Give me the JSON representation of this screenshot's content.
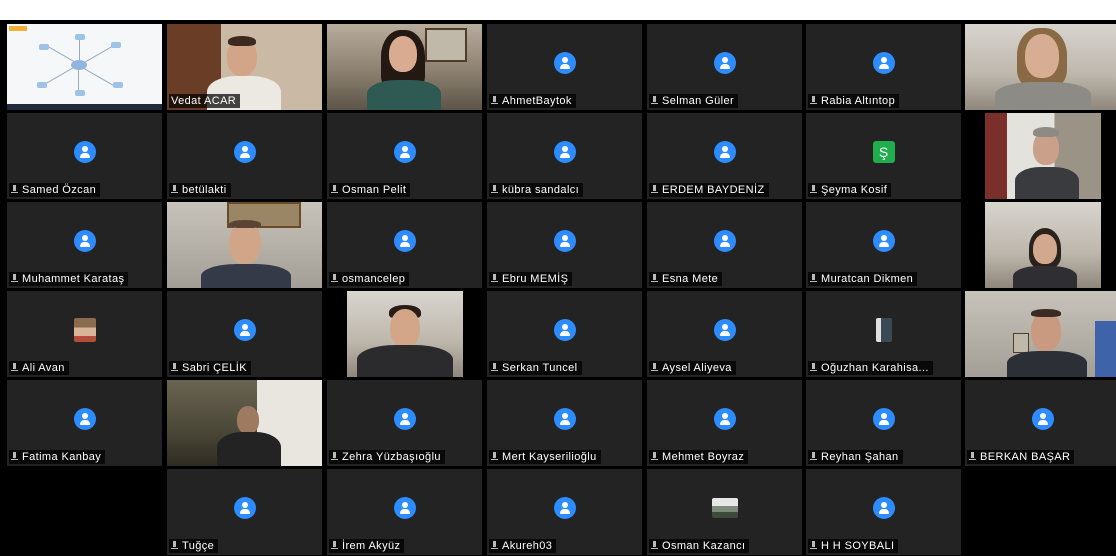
{
  "participants": {
    "screen_share": {
      "label": ""
    },
    "vedat": {
      "name": "Vedat ACAR"
    },
    "p2": {
      "name": ""
    },
    "ahmet": {
      "name": "AhmetBaytok"
    },
    "selman": {
      "name": "Selman Güler"
    },
    "rabia": {
      "name": "Rabia Altıntop"
    },
    "p7": {
      "name": ""
    },
    "samed": {
      "name": "Samed Özcan"
    },
    "betul": {
      "name": "betülakti"
    },
    "osman_pelit": {
      "name": "Osman Pelit"
    },
    "kubra": {
      "name": "kübra sandalcı"
    },
    "erdem": {
      "name": "ERDEM BAYDENİZ"
    },
    "seyma": {
      "name": "Şeyma Kosif",
      "initial": "Ş"
    },
    "p14": {
      "name": ""
    },
    "muhammet": {
      "name": "Muhammet Karataş"
    },
    "p16": {
      "name": ""
    },
    "osmancelep": {
      "name": "osmancelep"
    },
    "ebru": {
      "name": "Ebru MEMİŞ"
    },
    "esna": {
      "name": "Esna Mete"
    },
    "muratcan": {
      "name": "Muratcan Dikmen"
    },
    "p21": {
      "name": ""
    },
    "ali": {
      "name": "Ali Avan"
    },
    "sabri": {
      "name": "Sabri ÇELİK"
    },
    "p24": {
      "name": ""
    },
    "serkan": {
      "name": "Serkan Tuncel"
    },
    "aysel": {
      "name": "Aysel Aliyeva"
    },
    "oguzhan": {
      "name": "Oğuzhan Karahisa..."
    },
    "p28": {
      "name": ""
    },
    "fatima": {
      "name": "Fatima Kanbay"
    },
    "p30": {
      "name": ""
    },
    "zehra": {
      "name": "Zehra Yüzbaşıoğlu"
    },
    "mert": {
      "name": "Mert Kayserilioğlu"
    },
    "mehmet": {
      "name": "Mehmet Boyraz"
    },
    "reyhan": {
      "name": "Reyhan Şahan"
    },
    "berkan": {
      "name": "BERKAN BAŞAR"
    },
    "tugce": {
      "name": "Tuğçe"
    },
    "irem": {
      "name": "İrem Akyüz"
    },
    "akureh": {
      "name": "Akureh03"
    },
    "osman_kazanci": {
      "name": "Osman Kazancı"
    },
    "hh": {
      "name": "H H SOYBALI"
    }
  },
  "icons": {
    "avatar": "default-user-avatar-icon",
    "mic": "microphone-muted-icon"
  },
  "colors": {
    "avatar_blue": "#2d8cff",
    "tile_bg": "#232323",
    "initial_green": "#1fae4b",
    "active_speaker": "#23d959"
  }
}
